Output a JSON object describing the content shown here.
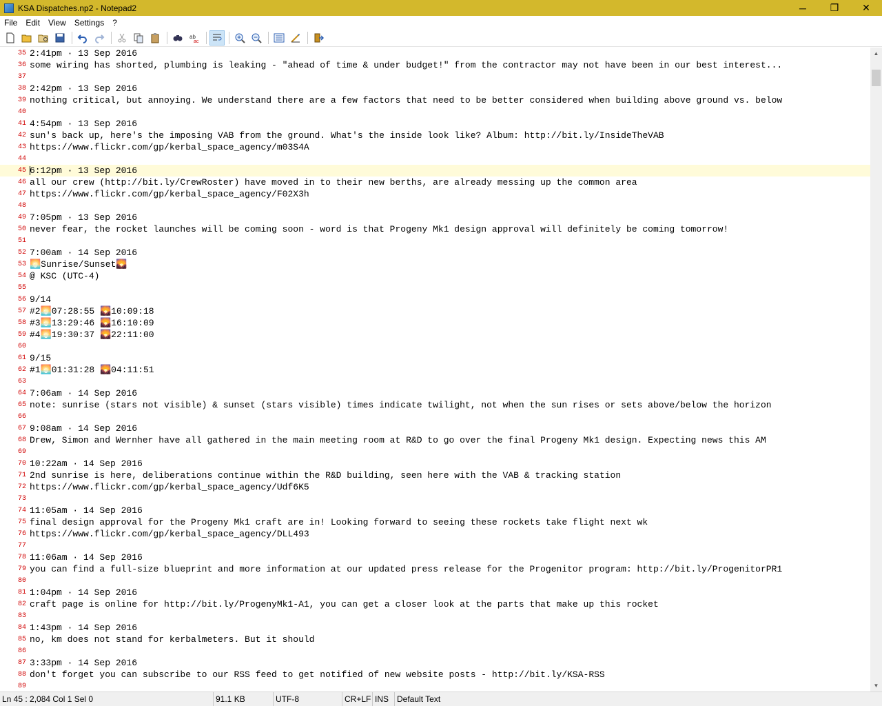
{
  "window": {
    "title": "KSA Dispatches.np2 - Notepad2",
    "minimize_glyph": "─",
    "restore_glyph": "❐",
    "close_glyph": "✕"
  },
  "menu": [
    "File",
    "Edit",
    "View",
    "Settings",
    "?"
  ],
  "toolbar": {
    "buttons": [
      "new-icon",
      "open-icon",
      "browse-icon",
      "save-icon",
      "undo-icon",
      "redo-icon",
      "cut-icon",
      "copy-icon",
      "paste-icon",
      "find-icon",
      "replace-icon",
      "word-wrap-icon",
      "zoom-in-icon",
      "zoom-out-icon",
      "scheme-icon",
      "customize-scheme-icon",
      "exit-icon"
    ]
  },
  "editor": {
    "current_line": 45,
    "lines": [
      {
        "n": "35",
        "t": "2:41pm · 13 Sep 2016"
      },
      {
        "n": "36",
        "t": "some wiring has shorted, plumbing is leaking - \"ahead of time & under budget!\" from the contractor may not have been in our best interest..."
      },
      {
        "n": "37",
        "t": ""
      },
      {
        "n": "38",
        "t": "2:42pm · 13 Sep 2016"
      },
      {
        "n": "39",
        "t": "nothing critical, but annoying. We understand there are a few factors that need to be better considered when building above ground vs. below"
      },
      {
        "n": "40",
        "t": ""
      },
      {
        "n": "41",
        "t": "4:54pm · 13 Sep 2016"
      },
      {
        "n": "42",
        "t": "sun's back up, here's the imposing VAB from the ground. What's the inside look like? Album: http://bit.ly/InsideTheVAB"
      },
      {
        "n": "43",
        "t": "https://www.flickr.com/gp/kerbal_space_agency/m03S4A"
      },
      {
        "n": "44",
        "t": ""
      },
      {
        "n": "45",
        "t": "6:12pm · 13 Sep 2016"
      },
      {
        "n": "46",
        "t": "all our crew (http://bit.ly/CrewRoster) have moved in to their new berths, are already messing up the common area"
      },
      {
        "n": "47",
        "t": "https://www.flickr.com/gp/kerbal_space_agency/F02X3h"
      },
      {
        "n": "48",
        "t": ""
      },
      {
        "n": "49",
        "t": "7:05pm · 13 Sep 2016"
      },
      {
        "n": "50",
        "t": "never fear, the rocket launches will be coming soon - word is that Progeny Mk1 design approval will definitely be coming tomorrow!"
      },
      {
        "n": "51",
        "t": ""
      },
      {
        "n": "52",
        "t": "7:00am · 14 Sep 2016"
      },
      {
        "n": "53",
        "t": "🌅Sunrise/Sunset🌄"
      },
      {
        "n": "54",
        "t": "@ KSC (UTC-4)"
      },
      {
        "n": "55",
        "t": ""
      },
      {
        "n": "56",
        "t": "9/14"
      },
      {
        "n": "57",
        "t": "#2🌅07:28:55 🌄10:09:18"
      },
      {
        "n": "58",
        "t": "#3🌅13:29:46 🌄16:10:09"
      },
      {
        "n": "59",
        "t": "#4🌅19:30:37 🌄22:11:00"
      },
      {
        "n": "60",
        "t": ""
      },
      {
        "n": "61",
        "t": "9/15"
      },
      {
        "n": "62",
        "t": "#1🌅01:31:28 🌄04:11:51"
      },
      {
        "n": "63",
        "t": ""
      },
      {
        "n": "64",
        "t": "7:06am · 14 Sep 2016"
      },
      {
        "n": "65",
        "t": "note: sunrise (stars not visible) & sunset (stars visible) times indicate twilight, not when the sun rises or sets above/below the horizon"
      },
      {
        "n": "66",
        "t": ""
      },
      {
        "n": "67",
        "t": "9:08am · 14 Sep 2016"
      },
      {
        "n": "68",
        "t": "Drew, Simon and Wernher have all gathered in the main meeting room at R&D to go over the final Progeny Mk1 design. Expecting news this AM"
      },
      {
        "n": "69",
        "t": ""
      },
      {
        "n": "70",
        "t": "10:22am · 14 Sep 2016"
      },
      {
        "n": "71",
        "t": "2nd sunrise is here, deliberations continue within the R&D building, seen here with the VAB & tracking station"
      },
      {
        "n": "72",
        "t": "https://www.flickr.com/gp/kerbal_space_agency/Udf6K5"
      },
      {
        "n": "73",
        "t": ""
      },
      {
        "n": "74",
        "t": "11:05am · 14 Sep 2016"
      },
      {
        "n": "75",
        "t": "final design approval for the Progeny Mk1 craft are in! Looking forward to seeing these rockets take flight next wk"
      },
      {
        "n": "76",
        "t": "https://www.flickr.com/gp/kerbal_space_agency/DLL493"
      },
      {
        "n": "77",
        "t": ""
      },
      {
        "n": "78",
        "t": "11:06am · 14 Sep 2016"
      },
      {
        "n": "79",
        "t": "you can find a full-size blueprint and more information at our updated press release for the Progenitor program: http://bit.ly/ProgenitorPR1"
      },
      {
        "n": "80",
        "t": ""
      },
      {
        "n": "81",
        "t": "1:04pm · 14 Sep 2016"
      },
      {
        "n": "82",
        "t": "craft page is online for http://bit.ly/ProgenyMk1-A1, you can get a closer look at the parts that make up this rocket"
      },
      {
        "n": "83",
        "t": ""
      },
      {
        "n": "84",
        "t": "1:43pm · 14 Sep 2016"
      },
      {
        "n": "85",
        "t": "no, km does not stand for kerbalmeters. But it should"
      },
      {
        "n": "86",
        "t": ""
      },
      {
        "n": "87",
        "t": "3:33pm · 14 Sep 2016"
      },
      {
        "n": "88",
        "t": "don't forget you can subscribe to our RSS feed to get notified of new website posts - http://bit.ly/KSA-RSS"
      },
      {
        "n": "89",
        "t": ""
      }
    ]
  },
  "scrollbar": {
    "up_glyph": "▲",
    "down_glyph": "▼"
  },
  "status": {
    "position": "Ln 45 : 2,084   Col 1   Sel 0",
    "size": "91.1 KB",
    "encoding": "UTF-8",
    "eol": "CR+LF",
    "mode": "INS",
    "scheme": "Default Text"
  }
}
